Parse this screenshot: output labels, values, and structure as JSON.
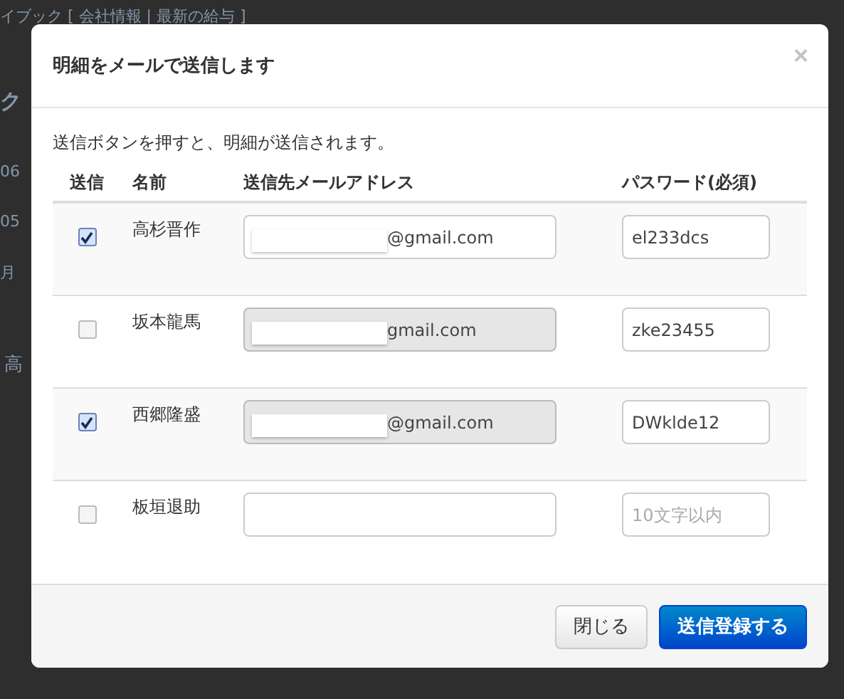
{
  "background_page": {
    "nav_text": "イブック [ 会社情報 | 最新の給与 ]",
    "heading_fragment": "ク",
    "month_labels": [
      "06",
      "05",
      "月"
    ],
    "table_fragment": "高"
  },
  "modal": {
    "title": "明細をメールで送信します",
    "close_label": "×",
    "description": "送信ボタンを押すと、明細が送信されます。",
    "columns": [
      "送信",
      "名前",
      "送信先メールアドレス",
      "パスワード(必須)"
    ],
    "rows": [
      {
        "checked": true,
        "name": "高杉晋作",
        "email": {
          "value": "@gmail.com",
          "disabled": false
        },
        "password": {
          "value": "el233dcs"
        }
      },
      {
        "checked": false,
        "name": "坂本龍馬",
        "email": {
          "value": "gmail.com",
          "disabled": true
        },
        "password": {
          "value": "zke23455"
        }
      },
      {
        "checked": true,
        "name": "西郷隆盛",
        "email": {
          "value": "@gmail.com",
          "disabled": true
        },
        "password": {
          "value": "DWklde12"
        }
      },
      {
        "checked": false,
        "name": "板垣退助",
        "email": {
          "disabled": false
        },
        "password": {
          "placeholder": "10文字以内"
        }
      }
    ],
    "buttons": [
      {
        "label": "閉じる",
        "kind": "default"
      },
      {
        "label": "送信登録する",
        "kind": "primary"
      }
    ]
  }
}
